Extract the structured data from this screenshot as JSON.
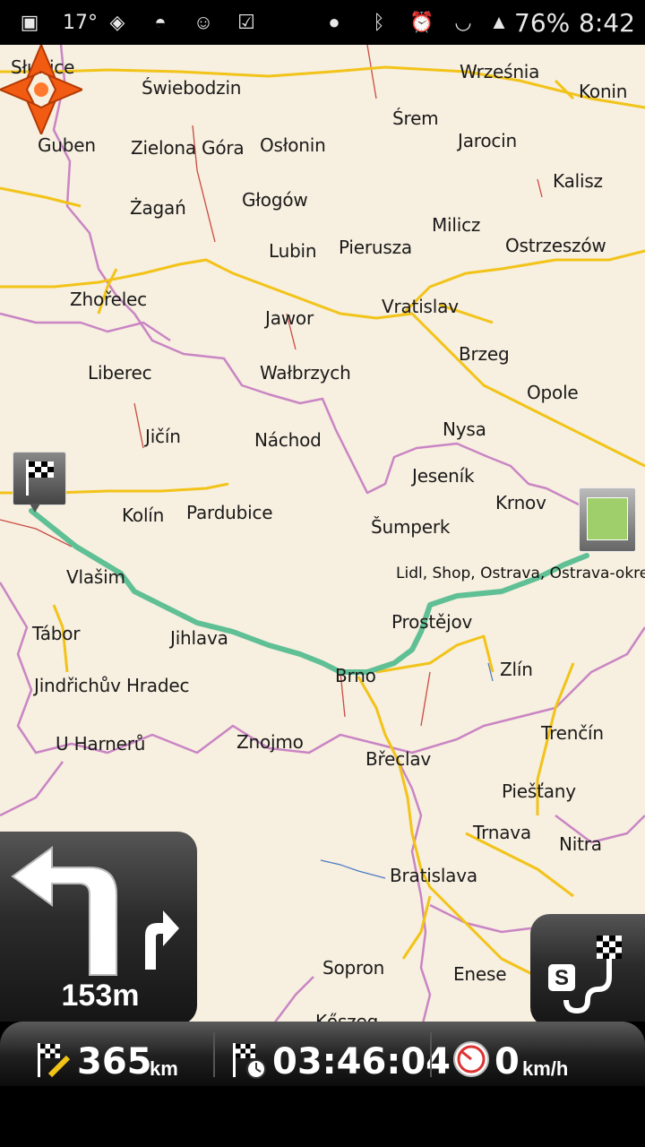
{
  "status_bar": {
    "temperature": "17°",
    "battery": "76%",
    "time": "8:42"
  },
  "map": {
    "cities": [
      {
        "id": "slubice",
        "name": "Słubice"
      },
      {
        "id": "swiebodzin",
        "name": "Świebodzin"
      },
      {
        "id": "wrzesnia",
        "name": "Września"
      },
      {
        "id": "konin",
        "name": "Konin"
      },
      {
        "id": "srem",
        "name": "Śrem"
      },
      {
        "id": "guben",
        "name": "Guben"
      },
      {
        "id": "zielona-gora",
        "name": "Zielona Góra"
      },
      {
        "id": "oslonin",
        "name": "Osłonin"
      },
      {
        "id": "jarocin",
        "name": "Jarocin"
      },
      {
        "id": "kalisz",
        "name": "Kalisz"
      },
      {
        "id": "zagan",
        "name": "Żagań"
      },
      {
        "id": "glogow",
        "name": "Głogów"
      },
      {
        "id": "milicz",
        "name": "Milicz"
      },
      {
        "id": "lubin",
        "name": "Lubin"
      },
      {
        "id": "pierusza",
        "name": "Pierusza"
      },
      {
        "id": "ostrzeszow",
        "name": "Ostrzeszów"
      },
      {
        "id": "zhorelec",
        "name": "Zhořelec"
      },
      {
        "id": "vratislav",
        "name": "Vratislav"
      },
      {
        "id": "jawor",
        "name": "Jawor"
      },
      {
        "id": "brzeg",
        "name": "Brzeg"
      },
      {
        "id": "liberec",
        "name": "Liberec"
      },
      {
        "id": "walbrzych",
        "name": "Wałbrzych"
      },
      {
        "id": "opole",
        "name": "Opole"
      },
      {
        "id": "jicin",
        "name": "Jičín"
      },
      {
        "id": "nachod",
        "name": "Náchod"
      },
      {
        "id": "nysa",
        "name": "Nysa"
      },
      {
        "id": "jesenik",
        "name": "Jeseník"
      },
      {
        "id": "krnov",
        "name": "Krnov"
      },
      {
        "id": "kolin",
        "name": "Kolín"
      },
      {
        "id": "pardubice",
        "name": "Pardubice"
      },
      {
        "id": "sumperk",
        "name": "Šumperk"
      },
      {
        "id": "vlasim",
        "name": "Vlašim"
      },
      {
        "id": "prostejov",
        "name": "Prostějov"
      },
      {
        "id": "tabor",
        "name": "Tábor"
      },
      {
        "id": "jihlava",
        "name": "Jihlava"
      },
      {
        "id": "zlin",
        "name": "Zlín"
      },
      {
        "id": "brno",
        "name": "Brno"
      },
      {
        "id": "jindrichuv-hradec",
        "name": "Jindřichův Hradec"
      },
      {
        "id": "u-harneru",
        "name": "U Harnerů"
      },
      {
        "id": "znojmo",
        "name": "Znojmo"
      },
      {
        "id": "trencin",
        "name": "Trenčín"
      },
      {
        "id": "breclav",
        "name": "Břeclav"
      },
      {
        "id": "piestany",
        "name": "Piešťany"
      },
      {
        "id": "trnava",
        "name": "Trnava"
      },
      {
        "id": "nitra",
        "name": "Nitra"
      },
      {
        "id": "bratislava",
        "name": "Bratislava"
      },
      {
        "id": "sopron",
        "name": "Sopron"
      },
      {
        "id": "enese",
        "name": "Enese"
      },
      {
        "id": "koszeg",
        "name": "Kőszeg"
      }
    ],
    "poi_label": "Lidl, Shop, Ostrava, Ostrava-okre"
  },
  "turn_instruction": {
    "distance": "153m"
  },
  "bottom_bar": {
    "remaining_distance_value": "365",
    "remaining_distance_unit": "km",
    "remaining_time": "03:46:04",
    "speed_value": "0",
    "speed_unit": "km/h"
  },
  "colors": {
    "map_background": "#f7efdf",
    "route": "#5fbf95",
    "major_road": "#f2c318",
    "border": "#c985c4",
    "minor_road": "#c94b43",
    "marker": "#f25b12"
  }
}
